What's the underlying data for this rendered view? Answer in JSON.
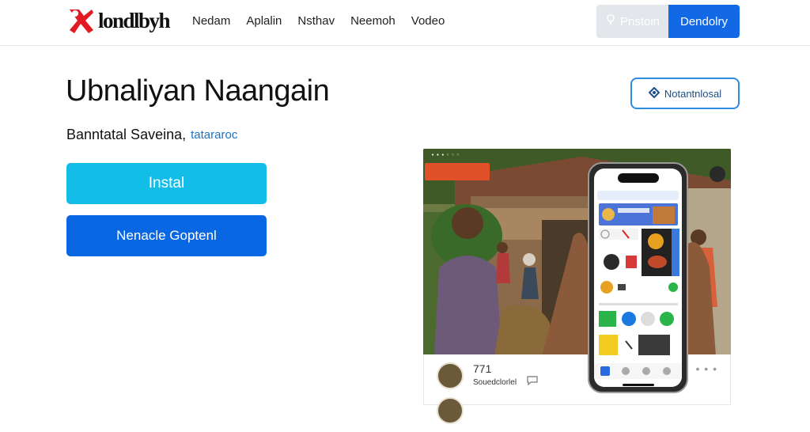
{
  "brand": {
    "name": "londlbyh",
    "color": "#e21b23"
  },
  "nav": {
    "links": [
      "Nedam",
      "Aplalin",
      "Nsthav",
      "Neemoh",
      "Vodeo"
    ]
  },
  "header": {
    "ghost_label": "Pnstoin",
    "primary_label": "Dendolry"
  },
  "hero": {
    "title": "Ubnaliyan Naangain",
    "subtitle": "Banntatal Saveina,",
    "subtitle_accent": "tatararoc",
    "install_label": "Instal",
    "secondary_label": "Nenacle Goptenl",
    "outline_label": "Notantnlosal"
  },
  "feed": {
    "count": "771",
    "caption": "Souedclorlel"
  },
  "colors": {
    "primary": "#1368e6",
    "install": "#12bde8",
    "secondary": "#0a67e3",
    "outline": "#2f8be0"
  }
}
